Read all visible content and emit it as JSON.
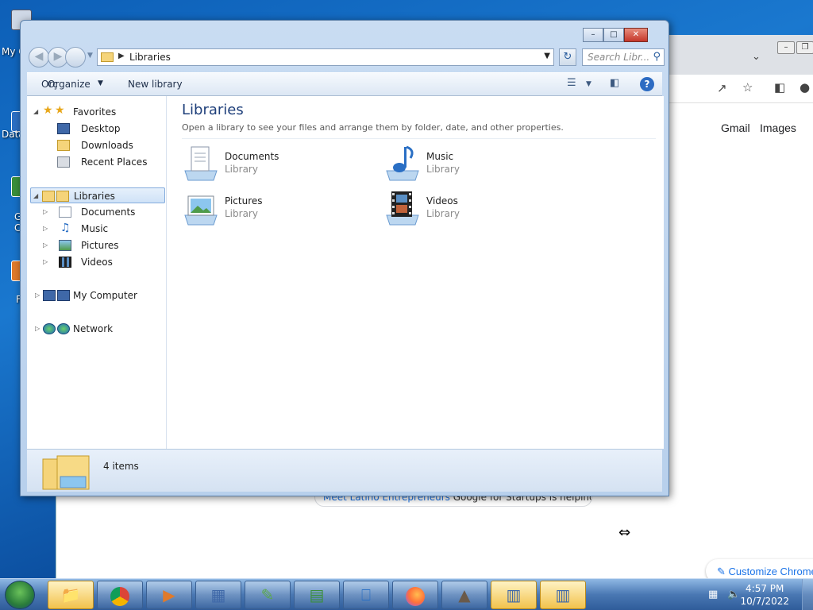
{
  "desktop": {
    "icons": [
      {
        "label": "My C",
        "icon": "computer-icon"
      },
      {
        "label": "Data",
        "icon": "shortcut-icon"
      },
      {
        "label": "G\nC",
        "icon": "shortcut-icon"
      },
      {
        "label": "F",
        "icon": "shortcut-icon"
      }
    ]
  },
  "chrome": {
    "links": {
      "gmail": "Gmail",
      "images": "Images"
    },
    "promo": {
      "link_text": "Meet Latino Entrepreneurs",
      "text": " Google for Startups is helping grow"
    },
    "customize": "Customize Chrome"
  },
  "explorer": {
    "address": {
      "path": "Libraries"
    },
    "search": {
      "placeholder": "Search Libr..."
    },
    "toolbar": {
      "organize_label": "Orç",
      "organize": "Organize",
      "new_library": "New library"
    },
    "nav": {
      "favorites": "Favorites",
      "desktop": "Desktop",
      "downloads": "Downloads",
      "recent_places": "Recent Places",
      "libraries": "Libraries",
      "documents": "Documents",
      "music": "Music",
      "pictures": "Pictures",
      "videos": "Videos",
      "my_computer": "My Computer",
      "network": "Network"
    },
    "content": {
      "title": "Libraries",
      "subtitle": "Open a library to see your files and arrange them by folder, date, and other properties.",
      "items": [
        {
          "name": "Documents",
          "type": "Library",
          "icon": "documents-library-icon"
        },
        {
          "name": "Music",
          "type": "Library",
          "icon": "music-library-icon"
        },
        {
          "name": "Pictures",
          "type": "Library",
          "icon": "pictures-library-icon"
        },
        {
          "name": "Videos",
          "type": "Library",
          "icon": "videos-library-icon"
        }
      ]
    },
    "status": {
      "count": "4 items"
    }
  },
  "taskbar": {
    "apps": [
      {
        "name": "Windows Explorer",
        "icon": "folder-icon"
      },
      {
        "name": "Google Chrome",
        "icon": "chrome-icon"
      },
      {
        "name": "Media Player",
        "icon": "media-player-icon"
      },
      {
        "name": "Control Panel",
        "icon": "control-panel-icon"
      },
      {
        "name": "Notepad++",
        "icon": "notepad-plus-icon"
      },
      {
        "name": "Text Editor",
        "icon": "text-editor-icon"
      },
      {
        "name": "Remote Desktop",
        "icon": "remote-desktop-icon"
      },
      {
        "name": "Firefox",
        "icon": "firefox-icon"
      },
      {
        "name": "App",
        "icon": "app-icon"
      },
      {
        "name": "Scheduler 1",
        "icon": "scheduler-icon"
      },
      {
        "name": "Scheduler 2",
        "icon": "scheduler-icon"
      }
    ],
    "clock": {
      "time": "4:57 PM",
      "date": "10/7/2022"
    }
  },
  "colors": {
    "desktop_bg": "#0d5fb7",
    "explorer_frame": "#c9dcf2",
    "library_title": "#1e3f7a",
    "selection": "#cfe2f7",
    "close_button": "#c4362a",
    "link_blue": "#1a73e8"
  }
}
